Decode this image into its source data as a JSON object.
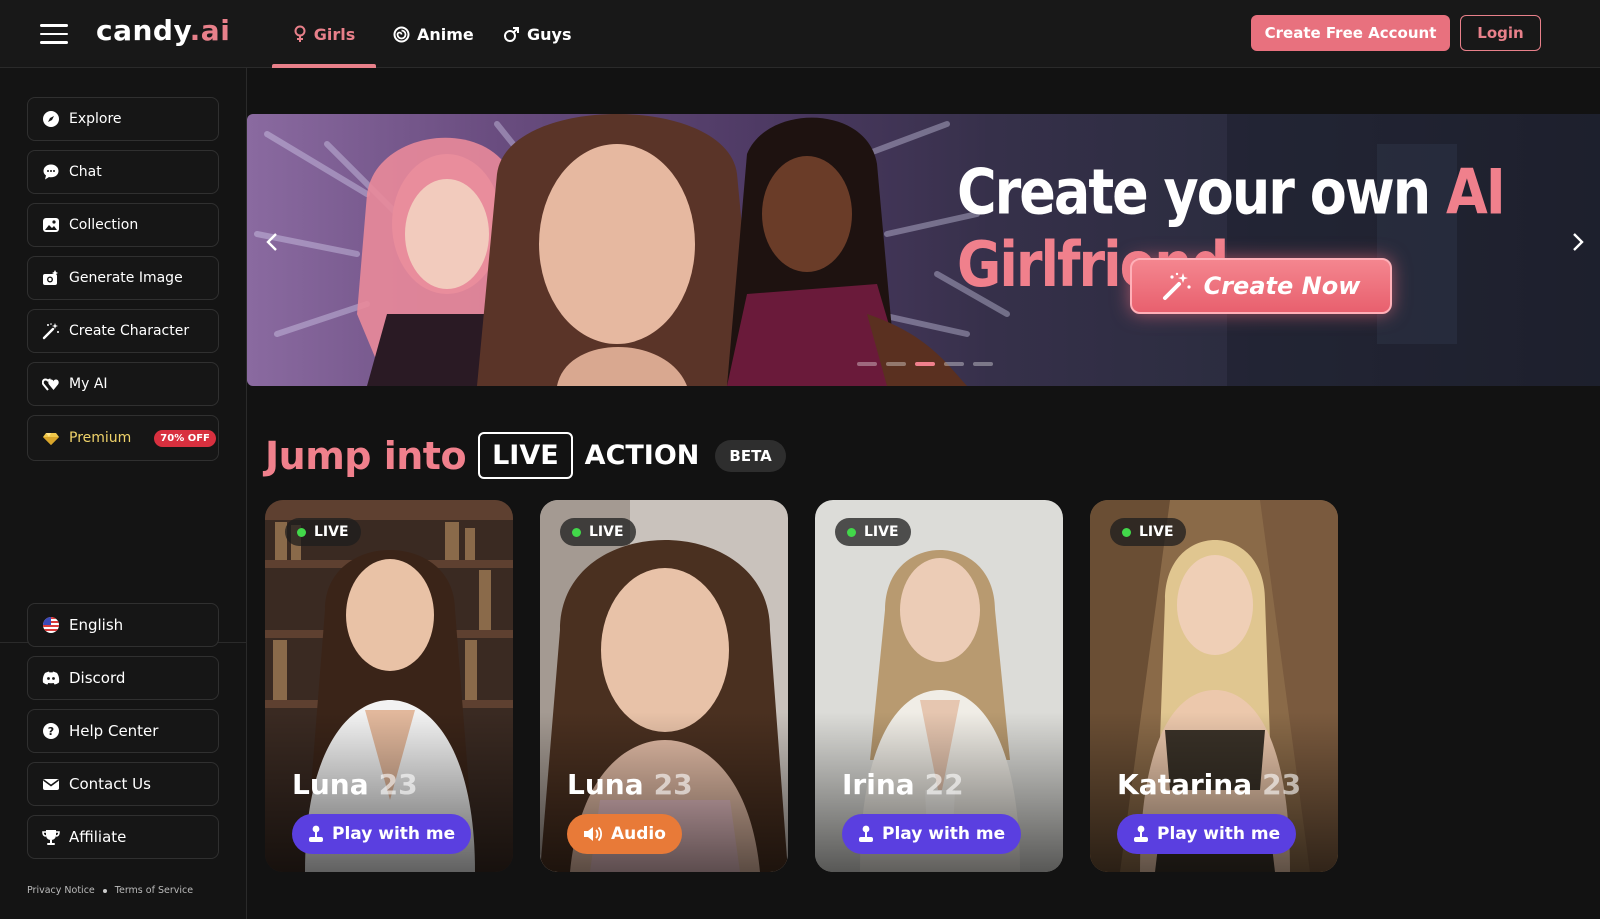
{
  "header": {
    "logo_main": "candy",
    "logo_ai": ".ai",
    "tabs": [
      {
        "label": "Girls",
        "icon": "female-icon",
        "active": true
      },
      {
        "label": "Anime",
        "icon": "swirl-icon",
        "active": false
      },
      {
        "label": "Guys",
        "icon": "male-icon",
        "active": false
      }
    ],
    "create_account": "Create Free Account",
    "login": "Login"
  },
  "sidebar": {
    "items": [
      {
        "label": "Explore",
        "icon": "compass-icon"
      },
      {
        "label": "Chat",
        "icon": "chat-icon"
      },
      {
        "label": "Collection",
        "icon": "gallery-icon"
      },
      {
        "label": "Generate Image",
        "icon": "camera-icon"
      },
      {
        "label": "Create Character",
        "icon": "magic-wand-icon"
      },
      {
        "label": "My AI",
        "icon": "hearts-icon"
      },
      {
        "label": "Premium",
        "icon": "diamond-icon",
        "badge": "70% OFF"
      }
    ],
    "bottom_items": [
      {
        "label": "English",
        "icon": "us-flag-icon"
      },
      {
        "label": "Discord",
        "icon": "discord-icon"
      },
      {
        "label": "Help Center",
        "icon": "help-icon"
      },
      {
        "label": "Contact Us",
        "icon": "mail-icon"
      },
      {
        "label": "Affiliate",
        "icon": "trophy-icon"
      }
    ],
    "privacy": "Privacy Notice",
    "terms": "Terms of Service"
  },
  "banner": {
    "title_white": "Create your own",
    "title_pink": "AI Girlfriend",
    "cta": "Create Now",
    "slides": 5,
    "active_slide": 3
  },
  "section": {
    "jump": "Jump into",
    "live": "LIVE",
    "action": "ACTION",
    "beta": "BETA"
  },
  "cards": [
    {
      "name": "Luna",
      "age": "23",
      "status": "LIVE",
      "button": "Play with me",
      "button_type": "play"
    },
    {
      "name": "Luna",
      "age": "23",
      "status": "LIVE",
      "button": "Audio",
      "button_type": "audio"
    },
    {
      "name": "Irina",
      "age": "22",
      "status": "LIVE",
      "button": "Play with me",
      "button_type": "play"
    },
    {
      "name": "Katarina",
      "age": "23",
      "status": "LIVE",
      "button": "Play with me",
      "button_type": "play"
    }
  ],
  "colors": {
    "accent": "#e8808a",
    "background": "#121212",
    "play_button": "#5a3fe0",
    "audio_button": "#e87a38",
    "live_dot": "#42d84a"
  }
}
